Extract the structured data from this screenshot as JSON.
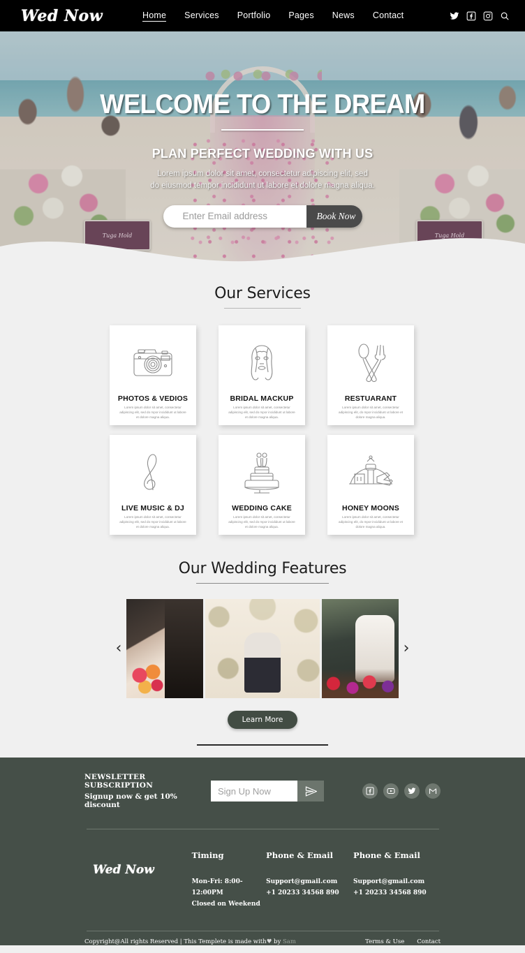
{
  "header": {
    "brand": "Wed Now",
    "nav": [
      {
        "label": "Home",
        "active": true
      },
      {
        "label": "Services",
        "active": false
      },
      {
        "label": "Portfolio",
        "active": false
      },
      {
        "label": "Pages",
        "active": false
      },
      {
        "label": "News",
        "active": false
      },
      {
        "label": "Contact",
        "active": false
      }
    ],
    "icons": [
      "twitter-icon",
      "facebook-icon",
      "instagram-icon",
      "search-icon"
    ]
  },
  "hero": {
    "title": "WELCOME TO THE DREAM",
    "subtitle": "PLAN PERFECT WEDDING WITH US",
    "paragraph_line1": "Lorem ipsum dolor sit amet, consectetur adipiscing elit, sed",
    "paragraph_line2": "do eiusmod tempor incididunt ut labore et dolore magna aliqua.",
    "email_placeholder": "Enter Email address",
    "email_value": "",
    "book_button": "Book Now",
    "sign_left": "Tuga Hold",
    "sign_right": "Tuga Hold"
  },
  "services": {
    "title": "Our Services",
    "cards": [
      {
        "name": "PHOTOS & VEDIOS",
        "desc": "Lorem ipsum dolor sit amet, consectetur adipiscing elit, sed do mpor incididunt ut labore et dolore magna aliqua.",
        "icon": "camera-icon"
      },
      {
        "name": "BRIDAL MACKUP",
        "desc": "Lorem ipsum dolor sit amet, consectetur adipiscing elit, sed do mpor incididunt ut labore et dolore magna aliqua.",
        "icon": "bridal-face-icon"
      },
      {
        "name": "RESTUARANT",
        "desc": "Lorem ipsum dolor sit amet, consectetur adipiscing elit, do mpor incididunt ut labore et dolore magna aliqua.",
        "icon": "spoon-fork-icon"
      },
      {
        "name": "LIVE MUSIC & DJ",
        "desc": "Lorem ipsum dolor sit amet, consectetur adipiscing elit, sed do mpor incididunt ut labore et dolore magna aliqua.",
        "icon": "music-note-icon"
      },
      {
        "name": "WEDDING CAKE",
        "desc": "Lorem ipsum dolor sit amet, consectetur adipiscing elit, sed do mpor incididunt ut labore et dolore magna aliqua.",
        "icon": "wedding-cake-icon"
      },
      {
        "name": "HONEY MOONS",
        "desc": "Lorem ipsum dolor sit amet, consectetur adipiscing elit, do mpor incididunt ut labore et dolore magna aliqua.",
        "icon": "airport-plane-icon"
      }
    ]
  },
  "features": {
    "title": "Our Wedding Features",
    "prev_arrow": "‹",
    "next_arrow": "›",
    "learn_more": "Learn More",
    "slides": [
      {
        "alt": "bride-and-groom-with-bouquet"
      },
      {
        "alt": "couple-under-floral-arch"
      },
      {
        "alt": "groom-kissing-bride-with-flowers"
      }
    ]
  },
  "footer": {
    "newsletter": {
      "title": "NEWSLETTER SUBSCRIPTION",
      "subtitle": "Signup now & get 10% discount",
      "placeholder": "Sign Up Now",
      "value": "",
      "send_icon": "paper-plane-icon"
    },
    "socials": [
      "facebook-icon",
      "youtube-icon",
      "twitter-icon",
      "gmail-icon"
    ],
    "brand": "Wed Now",
    "columns": [
      {
        "heading": "Timing",
        "line1": "Mon-Fri: 8:00-12:00PM",
        "line2": "Closed on Weekend"
      },
      {
        "heading": "Phone & Email",
        "line1": "Support@gmail.com",
        "line2": "+1 20233 34568 890"
      },
      {
        "heading": "Phone & Email",
        "line1": "Support@gmail.com",
        "line2": "+1 20233 34568 890"
      }
    ],
    "copyright_pre": "Copyright@All rights Reserved | This Templete is made with",
    "copyright_heart": "♥",
    "copyright_by": "by",
    "copyright_author": "Sam",
    "links": [
      {
        "label": "Terms & Use"
      },
      {
        "label": "Contact"
      }
    ]
  },
  "colors": {
    "header_bg": "#000000",
    "footer_bg": "#454f48",
    "page_bg": "#f0f0f0",
    "accent_button": "#424c43"
  }
}
